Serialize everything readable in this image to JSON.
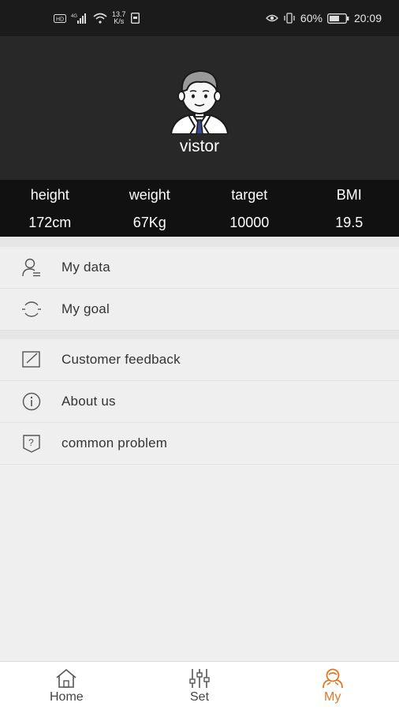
{
  "status_bar": {
    "network_speed_value": "13.7",
    "network_speed_unit": "K/s",
    "battery_percent": "60%",
    "time": "20:09"
  },
  "profile": {
    "username": "vistor"
  },
  "stats": [
    {
      "label": "height",
      "value": "172cm"
    },
    {
      "label": "weight",
      "value": "67Kg"
    },
    {
      "label": "target",
      "value": "10000"
    },
    {
      "label": "BMI",
      "value": "19.5"
    }
  ],
  "menu": {
    "group1": [
      {
        "label": "My data",
        "icon": "user-data-icon"
      },
      {
        "label": "My goal",
        "icon": "goal-icon"
      }
    ],
    "group2": [
      {
        "label": "Customer feedback",
        "icon": "feedback-edit-icon"
      },
      {
        "label": "About us",
        "icon": "info-icon"
      },
      {
        "label": "common problem",
        "icon": "question-icon"
      }
    ]
  },
  "tabs": [
    {
      "label": "Home",
      "icon": "home-icon",
      "active": false
    },
    {
      "label": "Set",
      "icon": "sliders-icon",
      "active": false
    },
    {
      "label": "My",
      "icon": "my-profile-icon",
      "active": true
    }
  ],
  "colors": {
    "accent": "#e07826",
    "header_bg": "#282828",
    "stats_bg": "#111111"
  }
}
